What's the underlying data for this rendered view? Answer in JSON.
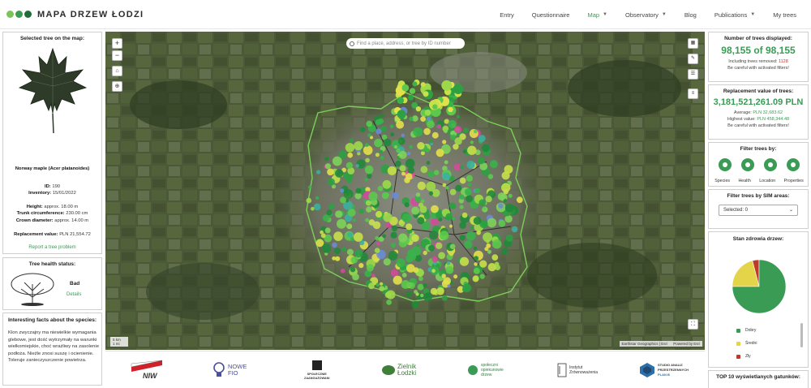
{
  "header": {
    "title": "MAPA DRZEW ŁODZI",
    "nav": [
      {
        "label": "Entry",
        "dropdown": false,
        "active": false
      },
      {
        "label": "Questionnaire",
        "dropdown": false,
        "active": false
      },
      {
        "label": "Map",
        "dropdown": true,
        "active": true
      },
      {
        "label": "Observatory",
        "dropdown": true,
        "active": false
      },
      {
        "label": "Blog",
        "dropdown": false,
        "active": false
      },
      {
        "label": "Publications",
        "dropdown": true,
        "active": false
      },
      {
        "label": "My trees",
        "dropdown": false,
        "active": false
      }
    ]
  },
  "selected_tree": {
    "title": "Selected tree on the map:",
    "species": "Norway maple (Acer platanoides)",
    "id_label": "ID:",
    "id_value": "190",
    "inventory_label": "Inventory:",
    "inventory_value": "15/01/2022",
    "height_label": "Height:",
    "height_value": "approx. 18.00 m",
    "trunk_label": "Trunk circumference:",
    "trunk_value": "230.00 cm",
    "crown_label": "Crown diameter:",
    "crown_value": "approx. 14.00 m",
    "replacement_label": "Replacement value:",
    "replacement_value": "PLN 21,554.72",
    "report_link": "Report a tree problem"
  },
  "health": {
    "title": "Tree health status:",
    "status": "Bad",
    "details_link": "Details"
  },
  "facts": {
    "title": "Interesting facts about the species:",
    "text": "Klon zwyczajny ma niewielkie wymagania glebowe, jest dość wytrzymały na warunki wielkomiejskie, choć wrażliwy na zasolenie podłoża. Nieźle znosi suszę i ocienienie. Toleruje zanieczyszczenie powietrza."
  },
  "map": {
    "search_placeholder": "Find a place, address, or tree by ID number",
    "zoom_in": "+",
    "zoom_out": "−",
    "attribution": "Earthstar Geographics | Esri",
    "attribution_powered": "Powered by Esri",
    "scale_km": "5 km",
    "scale_mi": "1 mi"
  },
  "sponsors": [
    {
      "name": "NIW"
    },
    {
      "name": "NOWE",
      "name2": "FIO"
    },
    {
      "name": "SPOŁECZNIE",
      "name2": "ZAANGAŻOWANI"
    },
    {
      "name": "Zielnik",
      "name2": "Łodzki"
    },
    {
      "name": "społeczni",
      "name2": "opiekunowie",
      "name3": "drzew"
    },
    {
      "name": "Instytut",
      "name2": "Zrównoważenia"
    },
    {
      "name": "STUDIO ANALIZ",
      "name2": "PRZESTRZENNYCH",
      "name3": "PLAN B"
    }
  ],
  "count": {
    "title": "Number of trees displayed:",
    "value": "98,155 of 98,155",
    "removed_label": "Including trees removed:",
    "removed_value": "1128",
    "warning": "Be careful with activated filters!"
  },
  "replacement": {
    "title": "Replacement value of trees:",
    "value": "3,181,521,261.09 PLN",
    "average_label": "Average:",
    "average_value": "PLN 32,683.62",
    "highest_label": "Highest value:",
    "highest_value": "PLN 458,344.48",
    "warning": "Be careful with activated filters!"
  },
  "filter": {
    "title": "Filter trees by:",
    "options": [
      "Species",
      "Health",
      "Location",
      "Properties"
    ]
  },
  "sim": {
    "title": "Filter trees by SIM areas:",
    "selected": "Selected: 0"
  },
  "health_chart": {
    "title": "Stan zdrowia drzew:",
    "legend": [
      {
        "label": "Dobry",
        "color": "#3a9b55"
      },
      {
        "label": "Średni",
        "color": "#e3d44a"
      },
      {
        "label": "Zły",
        "color": "#c0392b"
      }
    ]
  },
  "chart_data": {
    "type": "pie",
    "title": "Stan zdrowia drzew:",
    "categories": [
      "Dobry",
      "Średni",
      "Zły"
    ],
    "values": [
      75,
      21,
      4
    ],
    "colors": [
      "#3a9b55",
      "#e3d44a",
      "#c0392b"
    ]
  },
  "top10": {
    "title": "TOP 10 wyświetlanych gatunków:"
  },
  "colors": {
    "accent": "#3a9b55",
    "logo_dot_1": "#7cc35a",
    "logo_dot_2": "#3a9b55",
    "logo_dot_3": "#1f6e3a"
  }
}
